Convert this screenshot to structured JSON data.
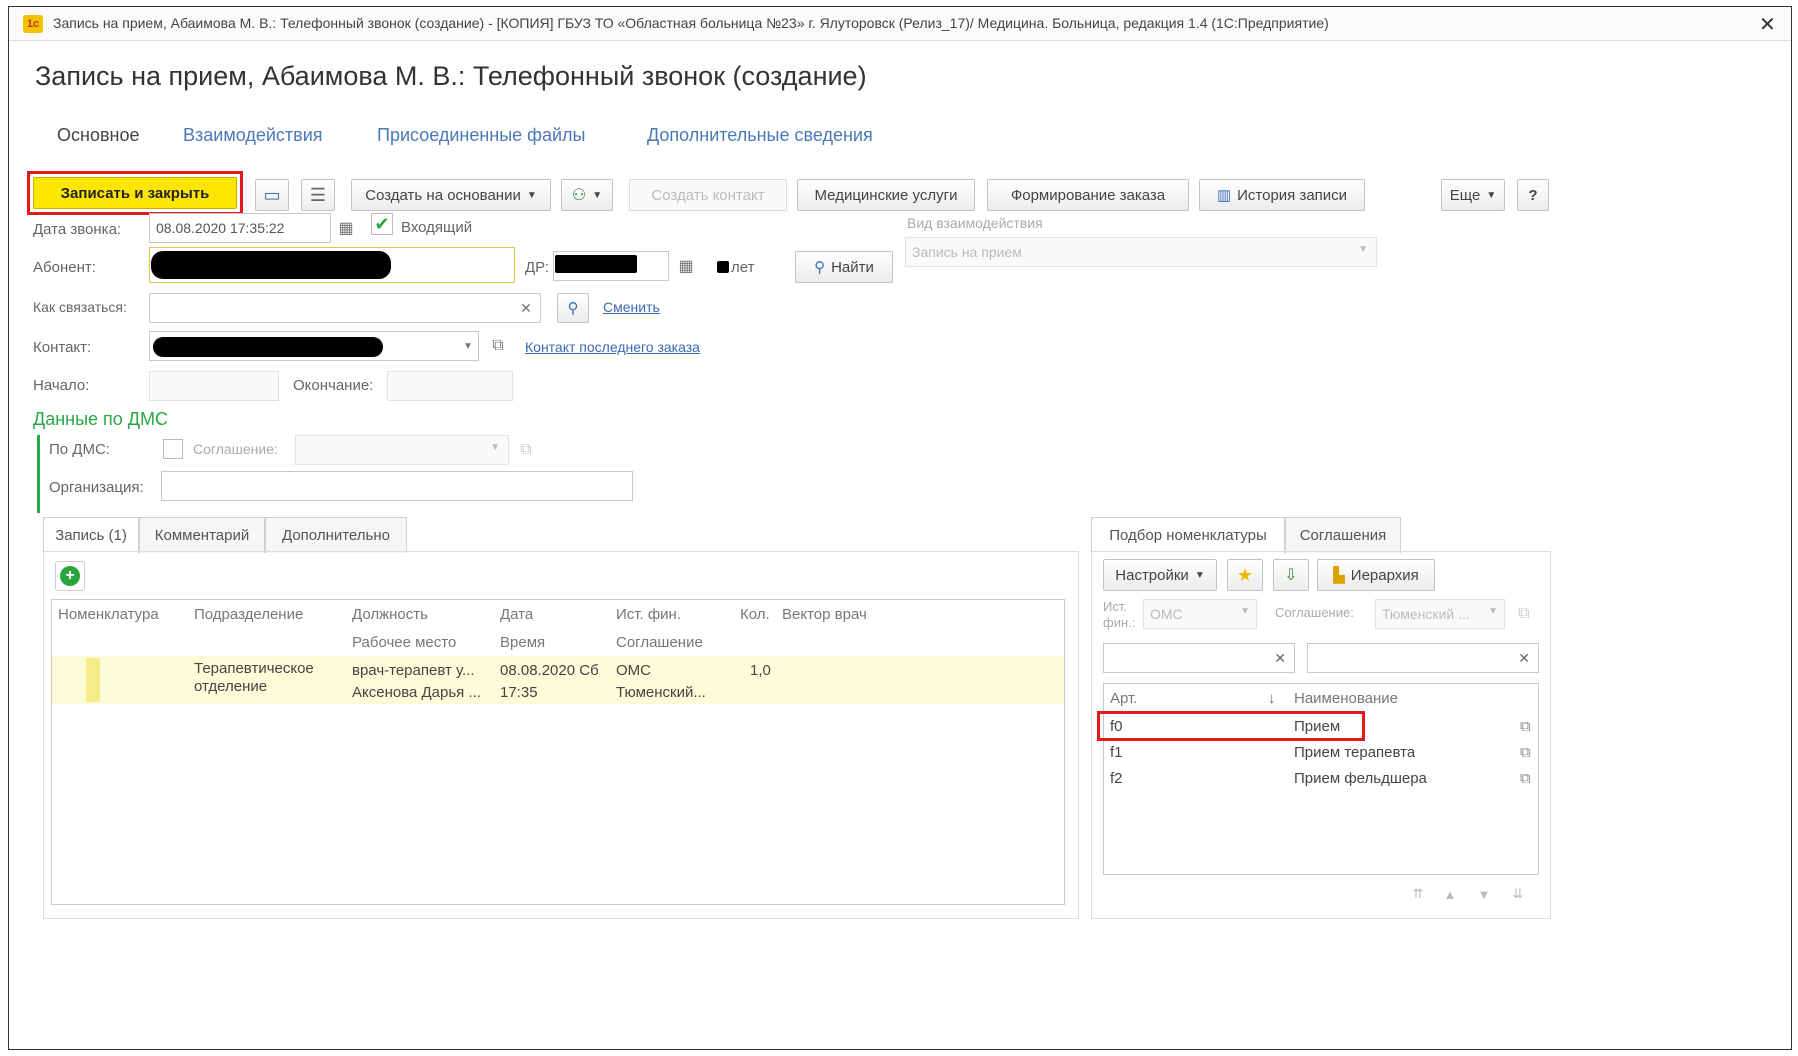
{
  "window": {
    "caption": "Запись на прием, Абаимова М. В.: Телефонный звонок (создание) - [КОПИЯ] ГБУЗ ТО «Областная больница №23» г. Ялуторовск (Релиз_17)/ Медицина. Больница, редакция 1.4 (1С:Предприятие)",
    "app_badge": "1c",
    "close_glyph": "✕"
  },
  "form": {
    "title": "Запись на прием, Абаимова М. В.: Телефонный звонок (создание)",
    "nav_tabs": [
      "Основное",
      "Взаимодействия",
      "Присоединенные файлы",
      "Дополнительные сведения"
    ]
  },
  "toolbar": {
    "save_close": "Записать и закрыть",
    "create_based": "Создать на основании",
    "create_contact": "Создать контакт",
    "medical_services": "Медицинские услуги",
    "order_forming": "Формирование заказа",
    "history": "История записи",
    "more": "Еще",
    "help": "?"
  },
  "fields": {
    "call_date_label": "Дата звонка:",
    "call_date_value": "08.08.2020 17:35:22",
    "incoming_label": "Входящий",
    "incoming_checked": true,
    "subscriber_label": "Абонент:",
    "dr_label": "ДР:",
    "years_label": "лет",
    "find_button": "Найти",
    "how_contact_label": "Как связаться:",
    "change_link": "Сменить",
    "contact_label": "Контакт:",
    "last_order_contact_link": "Контакт последнего заказа",
    "start_label": "Начало:",
    "end_label": "Окончание:",
    "interaction_type_label": "Вид взаимодействия",
    "interaction_type_value": "Запись на прием"
  },
  "dms": {
    "section_title": "Данные по ДМС",
    "by_dms_label": "По ДМС:",
    "agreement_label": "Соглашение:",
    "organization_label": "Организация:"
  },
  "bottom_tabs": [
    "Запись (1)",
    "Комментарий",
    "Дополнительно"
  ],
  "records_table": {
    "headers_row1": [
      "Номенклатура",
      "Подразделение",
      "Должность",
      "Дата",
      "Ист. фин.",
      "Кол.",
      "Вектор врач"
    ],
    "headers_row2": [
      "Рабочее место",
      "Время",
      "Соглашение"
    ],
    "rows": [
      {
        "nomenclature": "",
        "department": "Терапевтическое отделение",
        "position": "врач-терапевт у...",
        "workplace": "Аксенова Дарья ...",
        "date": "08.08.2020 Сб",
        "time": "17:35",
        "fin_source": "ОМС",
        "agreement": "Тюменский...",
        "qty": "1,0"
      }
    ]
  },
  "right_panel": {
    "tabs": [
      "Подбор номенклатуры",
      "Соглашения"
    ],
    "settings_button": "Настройки",
    "hierarchy_button": "Иерархия",
    "fin_source_label": "Ист. фин.:",
    "fin_source_value": "ОМС",
    "agreement_label": "Соглашение:",
    "agreement_value": "Тюменский ...",
    "columns": [
      "Арт.",
      "Наименование"
    ],
    "items": [
      {
        "art": "f0",
        "name": "Прием"
      },
      {
        "art": "f1",
        "name": "Прием терапевта"
      },
      {
        "art": "f2",
        "name": "Прием фельдшера"
      }
    ]
  },
  "colors": {
    "highlight_red": "#e21a1a",
    "primary_button": "#ffe600",
    "selected_row": "#fdfcd9",
    "link": "#3a6ab2",
    "dms_title": "#27a845"
  }
}
